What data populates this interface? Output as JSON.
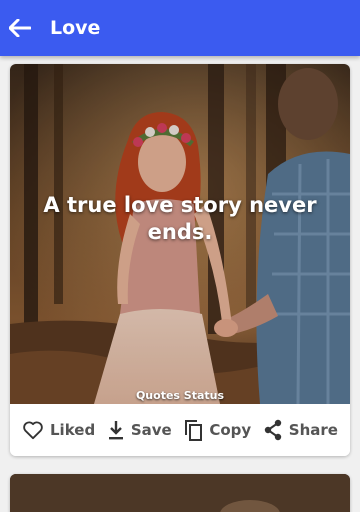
{
  "appbar": {
    "title": "Love",
    "back_icon": "arrow-left-icon",
    "color": "#3b5bf0"
  },
  "post": {
    "quote": "A true love story never ends.",
    "watermark": "Quotes Status",
    "actions": [
      {
        "label": "Liked",
        "icon": "heart-icon"
      },
      {
        "label": "Save",
        "icon": "download-icon"
      },
      {
        "label": "Copy",
        "icon": "copy-icon"
      },
      {
        "label": "Share",
        "icon": "share-icon"
      }
    ]
  }
}
